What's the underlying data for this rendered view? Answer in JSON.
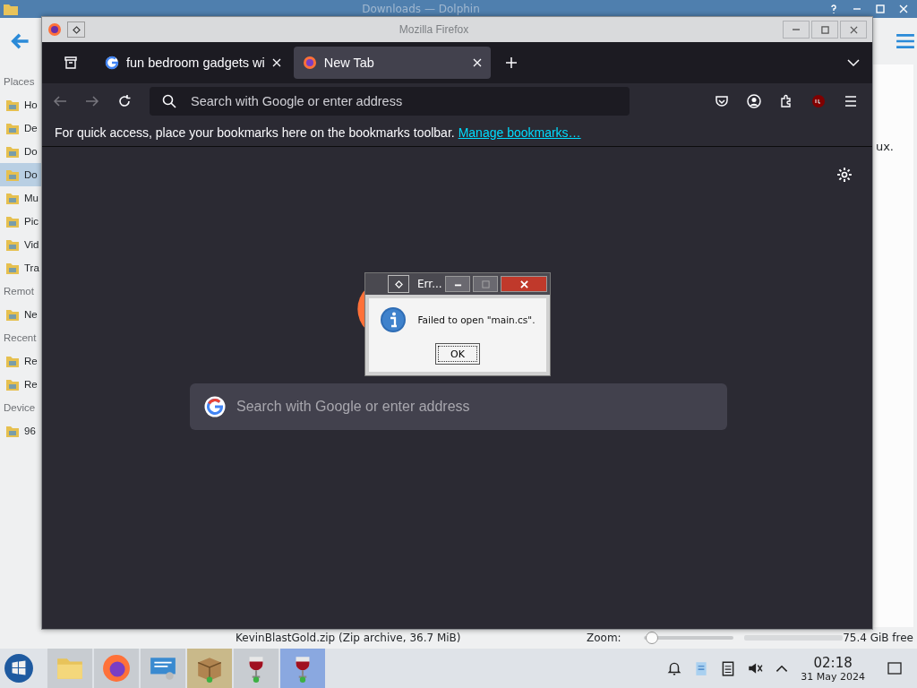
{
  "dolphin": {
    "title": "Downloads — Dolphin",
    "sidebar": [
      {
        "heading": "Places",
        "items": [
          {
            "label": "Ho",
            "selected": false
          },
          {
            "label": "De",
            "selected": false
          },
          {
            "label": "Do",
            "selected": false
          },
          {
            "label": "Do",
            "selected": true
          },
          {
            "label": "Mu",
            "selected": false
          },
          {
            "label": "Pic",
            "selected": false
          },
          {
            "label": "Vid",
            "selected": false
          },
          {
            "label": "Tra",
            "selected": false
          }
        ]
      },
      {
        "heading": "Remot",
        "items": [
          {
            "label": "Ne",
            "selected": false
          }
        ]
      },
      {
        "heading": "Recent",
        "items": [
          {
            "label": "Re",
            "selected": false
          },
          {
            "label": "Re",
            "selected": false
          }
        ]
      },
      {
        "heading": "Device",
        "items": [
          {
            "label": "96",
            "selected": false
          }
        ]
      }
    ],
    "content_text": "ux.",
    "status_bar": {
      "file": "KevinBlastGold.zip (Zip archive, 36.7 MiB)",
      "zoom_label": "Zoom:",
      "zoom": {
        "level": 0.02
      },
      "free_space": "75.4 GiB free"
    }
  },
  "firefox": {
    "title": "Mozilla Firefox",
    "tabs": [
      {
        "label": "fun bedroom gadgets wi",
        "kind": "google",
        "selected": false
      },
      {
        "label": "New Tab",
        "kind": "firefox",
        "selected": true
      }
    ],
    "address_placeholder": "Search with Google or enter address",
    "bookmarks_hint": "For quick access, place your bookmarks here on the bookmarks toolbar.",
    "bookmarks_link": "Manage bookmarks…",
    "search_placeholder": "Search with Google or enter address"
  },
  "dialog": {
    "title": "Err...",
    "message": "Failed to open \"main.cs\".",
    "button": "OK"
  },
  "taskbar": {
    "apps": [
      {
        "kind": "folder",
        "selected": false
      },
      {
        "kind": "firefox",
        "selected": false
      },
      {
        "kind": "monitor",
        "selected": false
      },
      {
        "kind": "package",
        "selected": false
      },
      {
        "kind": "wine",
        "selected": false
      },
      {
        "kind": "wine",
        "selected": true
      }
    ],
    "time": "02:18",
    "date": "31 May 2024"
  }
}
